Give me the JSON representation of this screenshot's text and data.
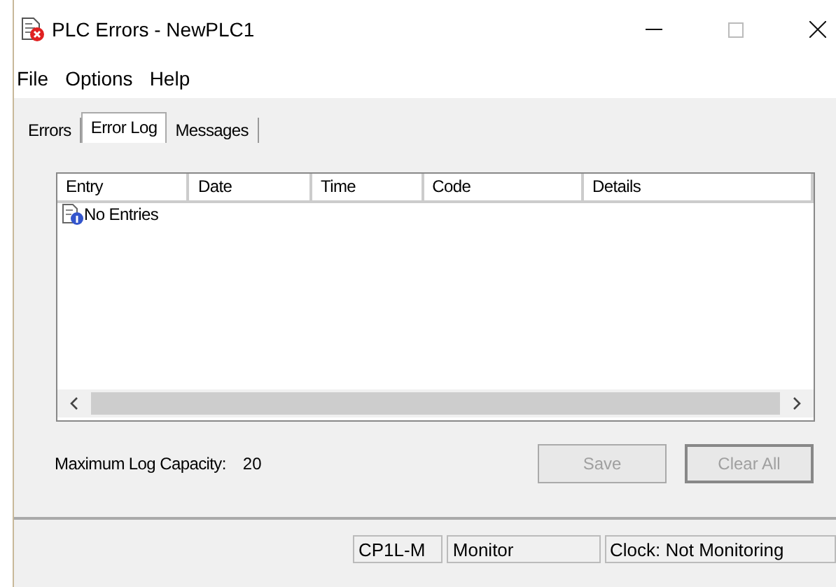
{
  "window": {
    "title": "PLC Errors - NewPLC1"
  },
  "menu": [
    {
      "label": "File"
    },
    {
      "label": "Options"
    },
    {
      "label": "Help"
    }
  ],
  "tabs": [
    {
      "label": "Errors",
      "selected": false
    },
    {
      "label": "Error Log",
      "selected": true
    },
    {
      "label": "Messages",
      "selected": false
    }
  ],
  "table": {
    "columns": [
      "Entry",
      "Date",
      "Time",
      "Code",
      "Details"
    ],
    "rows": [
      {
        "text": "No Entries"
      }
    ]
  },
  "capacity": {
    "label": "Maximum Log Capacity:",
    "value": "20"
  },
  "buttons": [
    {
      "label": "Save",
      "disabled": true,
      "default": false
    },
    {
      "label": "Clear All",
      "disabled": true,
      "default": true
    }
  ],
  "status_bar": [
    "CP1L-M",
    "Monitor",
    "Clock: Not Monitoring"
  ]
}
